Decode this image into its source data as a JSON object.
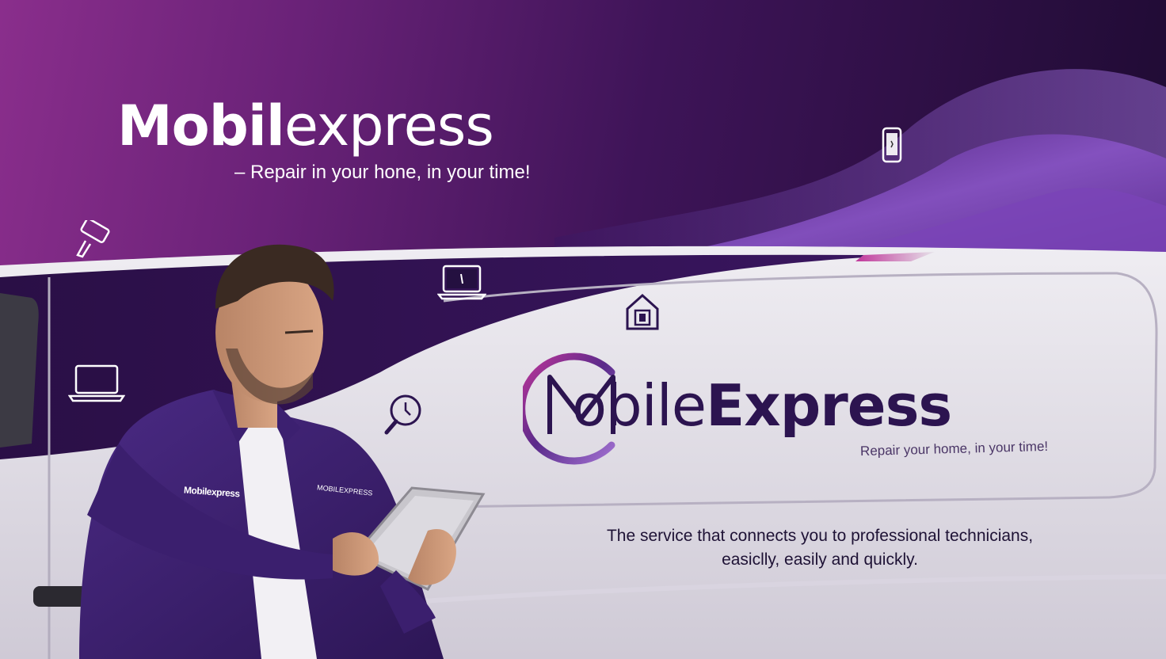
{
  "hero": {
    "title_part1": "Mobil",
    "title_part2": "express",
    "subtitle": "– Repair in your hone, in your time!"
  },
  "van": {
    "logo_part1": "obile",
    "logo_part2": "Express",
    "logo_letter": "M",
    "tagline": "Repair your home, in your time!",
    "description": "The service that connects you to professional technicians, easiclly, easily and quickly."
  },
  "technician": {
    "jacket_badge": "Mobilexpress",
    "jacket_badge_right": "MOBILEXPRESS"
  },
  "icons": [
    "smartphone-icon",
    "repair-tool-icon",
    "laptop-icon",
    "house-icon",
    "laptop-icon",
    "clock-magnifier-icon"
  ],
  "colors": {
    "brand_purple": "#5a2a8a",
    "accent_magenta": "#c0369a",
    "dark_purple": "#2c1450",
    "van_white": "#e6e3ea"
  }
}
